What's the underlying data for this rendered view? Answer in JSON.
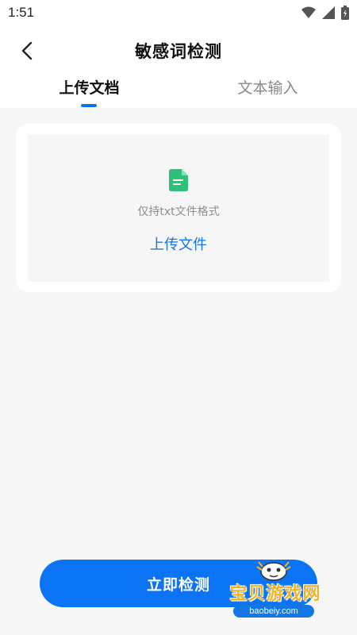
{
  "status_bar": {
    "time": "1:51",
    "icons": [
      "wifi-icon",
      "signal-icon",
      "battery-icon"
    ]
  },
  "header": {
    "title": "敏感词检测",
    "back_icon": "chevron-left-icon"
  },
  "tabs": [
    {
      "label": "上传文档",
      "active": true
    },
    {
      "label": "文本输入",
      "active": false
    }
  ],
  "upload": {
    "icon": "document-icon",
    "hint": "仅持txt文件格式",
    "link_label": "上传文件"
  },
  "action": {
    "detect_label": "立即检测"
  },
  "watermark": {
    "brand": "宝贝游戏网",
    "url": "baobeiy.com"
  },
  "colors": {
    "accent": "#0a74f5",
    "file_icon": "#2fbf7a",
    "watermark_text": "#f2b526"
  }
}
